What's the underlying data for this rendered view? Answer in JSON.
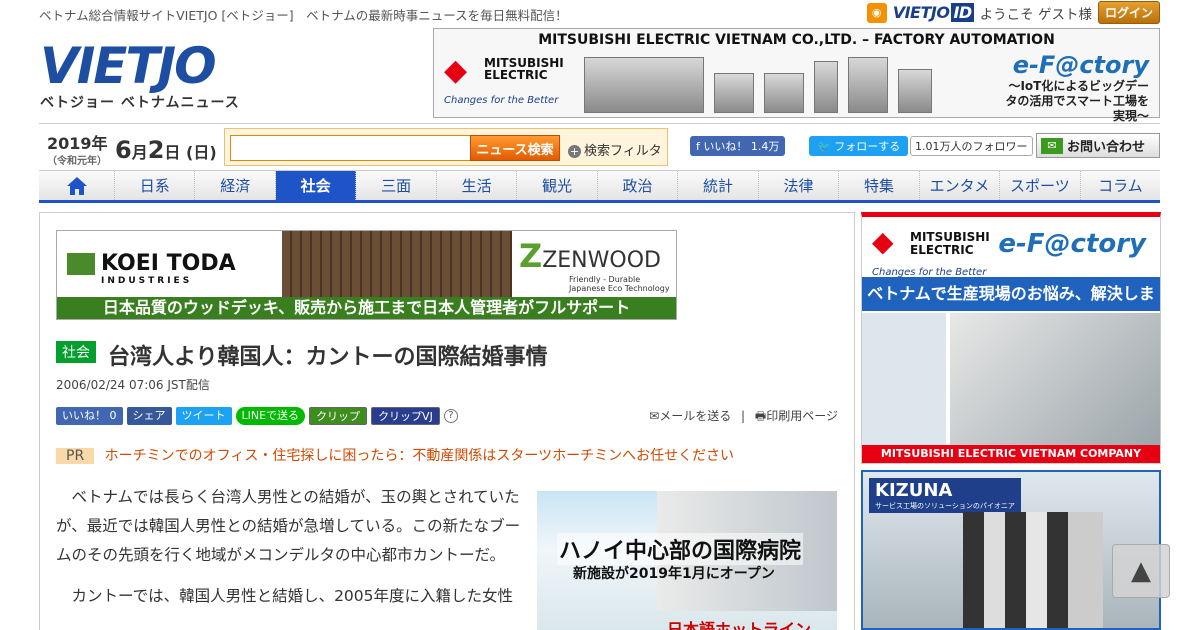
{
  "topbar": {
    "tagline": "ベトナム総合情報サイトVIETJO [ベトジョー]　ベトナムの最新時事ニュースを毎日無料配信！",
    "rss_icon": "rss-icon",
    "vietjo_id": "VIETJO",
    "vietjo_id_suffix": "ID",
    "welcome": "ようこそ ゲスト様",
    "login_label": "ログイン"
  },
  "logo": {
    "text": "VIETJO",
    "subtitle": "ベトジョー ベトナムニュース"
  },
  "header_ad": {
    "title": "MITSUBISHI ELECTRIC VIETNAM CO.,LTD. – FACTORY AUTOMATION",
    "brand": "MITSUBISHI ELECTRIC",
    "slogan": "Changes for the Better",
    "efactory": "e-F@ctory",
    "efactory_copy": "〜IoT化によるビッグデータの活用でスマート工場を実現〜"
  },
  "date": {
    "year": "2019年",
    "era": "（令和元年）",
    "month": "6",
    "day": "2",
    "weekday": "(日)"
  },
  "search": {
    "placeholder": "",
    "button": "ニュース検索",
    "filter": "検索フィルタ"
  },
  "social": {
    "fb_like": "いいね！ 1.4万",
    "tw_follow": "フォローする",
    "tw_followers": "1.01万人のフォロワー",
    "contact": "お問い合わせ"
  },
  "nav": {
    "home_icon": "home-icon",
    "items": [
      "日系",
      "経済",
      "社会",
      "三面",
      "生活",
      "観光",
      "政治",
      "統計",
      "法律",
      "特集",
      "エンタメ",
      "スポーツ",
      "コラム"
    ],
    "active": "社会"
  },
  "banner_ad": {
    "brand": "KOEI TODA",
    "brand_sub": "INDUSTRIES",
    "zenwood": "ZENWOOD",
    "zenwood_sub": "Friendly - Durable Japanese Eco Technology",
    "band": "日本品質のウッドデッキ、販売から施工まで日本人管理者がフルサポート"
  },
  "article": {
    "category": "社会",
    "headline": "台湾人より韓国人：カントーの国際結婚事情",
    "published": "2006/02/24 07:06 JST配信",
    "share": {
      "fb_like": "いいね！ 0",
      "fb_share": "シェア",
      "tweet": "ツイート",
      "line": "LINEで送る",
      "clip1": "クリップ",
      "clip2": "クリップVJ",
      "help": "?"
    },
    "mail": "メールを送る",
    "print": "印刷用ページ",
    "pr_tag": "PR",
    "pr_text": "ホーチミンでのオフィス・住宅探しに困ったら：不動産関係はスターツホーチミンへお任せください",
    "paragraphs": [
      "ベトナムでは長らく台湾人男性との結婚が、玉の輿とされていたが、最近では韓国人男性との結婚が急増している。この新たなブームのその先頭を行く地域がメコンデルタの中心都市カントーだ。",
      "カントーでは、韓国人男性と結婚し、2005年度に入籍した女性"
    ]
  },
  "hospital_ad": {
    "line1": "ハノイ中心部の国際病院",
    "line2": "新施設が2019年1月にオープン",
    "line3": "日本語ホットライン"
  },
  "side_ad1": {
    "brand": "MITSUBISHI ELECTRIC",
    "slogan": "Changes for the Better",
    "efactory": "e-F@ctory",
    "headline": "ベトナムで生産現場のお悩み、解決します。",
    "footer": "MITSUBISHI ELECTRIC VIETNAM COMPANY LIMITED"
  },
  "side_ad2": {
    "brand": "KIZUNA",
    "sub": "サービス工場のソリューションのパイオニア"
  },
  "to_top": "▲"
}
